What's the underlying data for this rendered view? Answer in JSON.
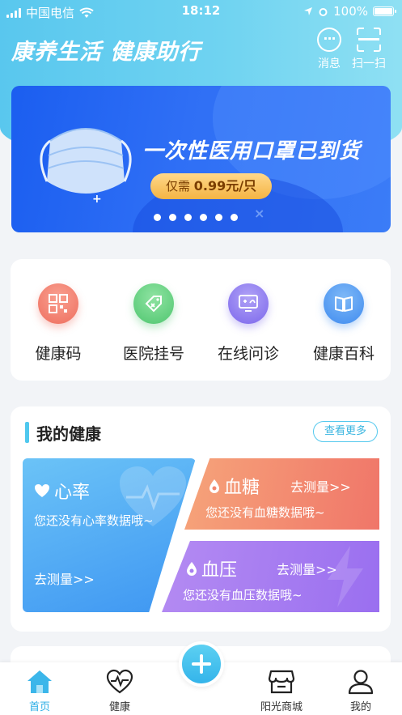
{
  "status_bar": {
    "carrier": "中国电信",
    "time": "18:12",
    "battery": "100%"
  },
  "header": {
    "title": "康养生活  健康助行",
    "message_label": "消息",
    "scan_label": "扫一扫"
  },
  "banner": {
    "title": "一次性医用口罩已到货",
    "price_prefix": "仅需",
    "price_value": "0.99元/只",
    "page_count": 6,
    "active_page": 0
  },
  "services": [
    {
      "label": "健康码",
      "icon": "qr-code-icon",
      "color": "#f07a68"
    },
    {
      "label": "医院挂号",
      "icon": "medicine-tag-icon",
      "color": "#5fd07c"
    },
    {
      "label": "在线问诊",
      "icon": "online-consult-icon",
      "color": "#8a78f0"
    },
    {
      "label": "健康百科",
      "icon": "book-icon",
      "color": "#3f96f0"
    }
  ],
  "my_health": {
    "title": "我的健康",
    "more_label": "查看更多",
    "heart_rate": {
      "title": "心率",
      "desc": "您还没有心率数据哦~",
      "go_label": "去测量>>"
    },
    "blood_sugar": {
      "title": "血糖",
      "desc": "您还没有血糖数据哦~",
      "go_label": "去测量>>"
    },
    "blood_pressure": {
      "title": "血压",
      "desc": "您还没有血压数据哦~",
      "go_label": "去测量>>"
    }
  },
  "tabbar": {
    "home": "首页",
    "health": "健康",
    "mall": "阳光商城",
    "mine": "我的",
    "active": "home",
    "active_color": "#2aaee6"
  }
}
